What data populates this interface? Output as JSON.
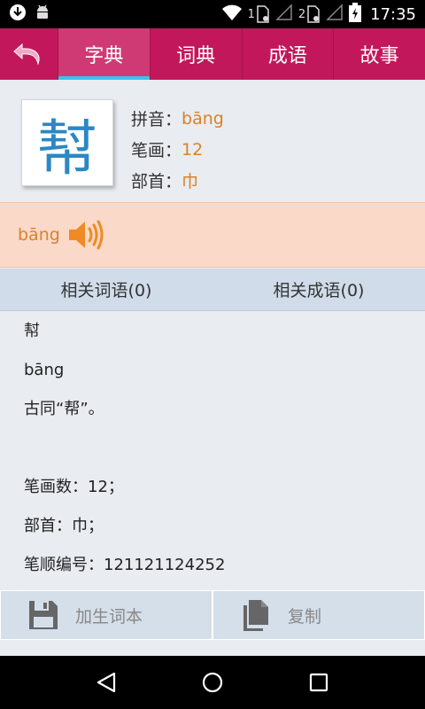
{
  "status_bar": {
    "time": "17:35",
    "sim1": "1",
    "sim2": "2"
  },
  "tabs": [
    {
      "label": "字典",
      "active": true
    },
    {
      "label": "词典",
      "active": false
    },
    {
      "label": "成语",
      "active": false
    },
    {
      "label": "故事",
      "active": false
    }
  ],
  "character": {
    "glyph": "幇",
    "pinyin_label": "拼音：",
    "pinyin": "bāng",
    "strokes_label": "笔画：",
    "strokes": "12",
    "radical_label": "部首：",
    "radical": "巾"
  },
  "pronunciation": {
    "text": "bāng"
  },
  "related": {
    "words_label": "相关词语(0)",
    "idioms_label": "相关成语(0)"
  },
  "content": {
    "lines": [
      "幇",
      "bāng",
      "古同“帮”。",
      "",
      "笔画数：12；",
      "部首：巾；",
      "笔顺编号：121121124252"
    ]
  },
  "actions": {
    "add_label": "加生词本",
    "copy_label": "复制"
  },
  "colors": {
    "header": "#c2185b",
    "tab_indicator": "#3fc0ea",
    "accent_value": "#d9822b",
    "char_blue": "#2a88c4",
    "pron_band": "#fbd9c8"
  }
}
